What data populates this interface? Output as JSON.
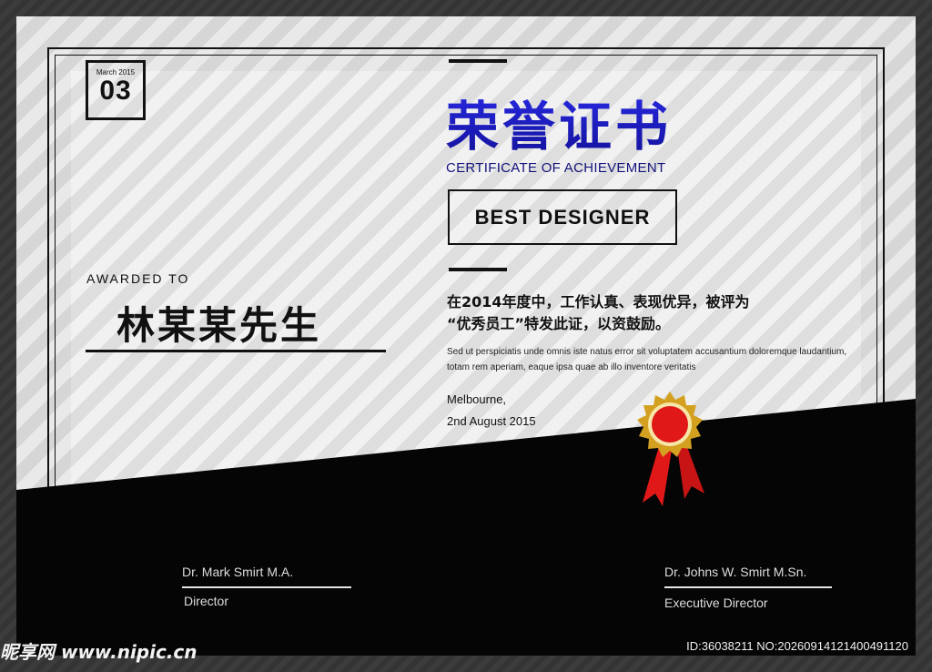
{
  "certificate": {
    "date_box": {
      "month": "March 2015",
      "day": "03"
    },
    "title_cn": "荣誉证书",
    "subtitle": "CERTIFICATE OF ACHIEVEMENT",
    "award": "BEST DESIGNER",
    "awarded_to_label": "AWARDED TO",
    "recipient": "林某某先生",
    "body_cn_line1": "在2014年度中，工作认真、表现优异，被评为",
    "body_cn_line2": "“优秀员工”特发此证，以资鼓励。",
    "body_latin": "Sed ut perspiciatis unde omnis iste natus error sit voluptatem accusantium doloremque laudantium, totam rem aperiam, eaque ipsa quae ab illo inventore veritatis",
    "place": "Melbourne,",
    "date": "2nd August 2015"
  },
  "signatures": [
    {
      "name": "Dr. Mark Smirt M.A.",
      "title": "Director"
    },
    {
      "name": "Dr. Johns W. Smirt M.Sn.",
      "title": "Executive Director"
    }
  ],
  "watermark": {
    "left": "昵享网 www.nipic.cn",
    "right": "ID:36038211 NO:20260914121400491120"
  },
  "colors": {
    "title_blue": "#1a1ad8",
    "subtitle_navy": "#12127a",
    "band_black": "#050505",
    "medal_gold": "#d4a020",
    "medal_red": "#e01818"
  }
}
